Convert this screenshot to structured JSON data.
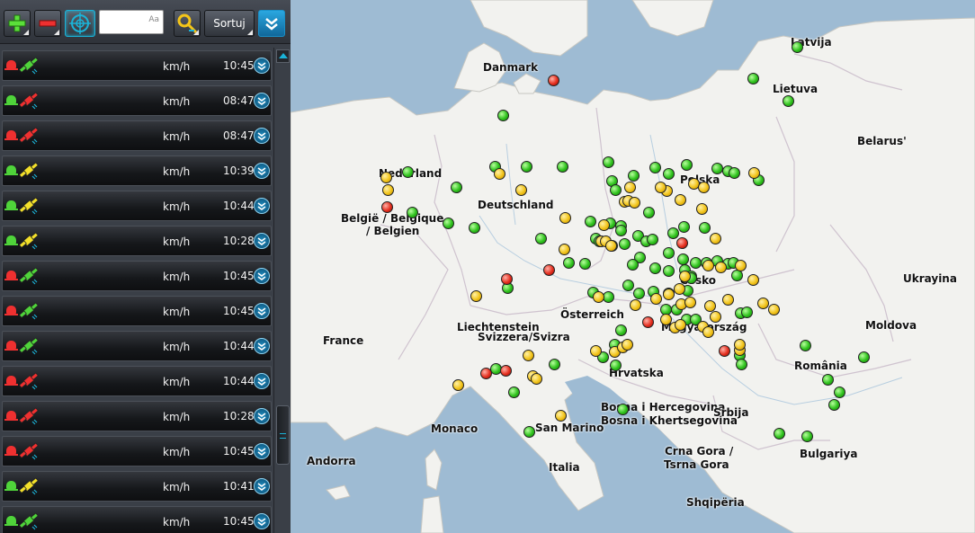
{
  "toolbar": {
    "search_value": "",
    "search_case_label": "Aa",
    "sort_label": "Sortuj"
  },
  "units": "km/h",
  "vehicles": [
    {
      "alarm": "red",
      "icon": "satellite-green-icon",
      "time": "10:45"
    },
    {
      "alarm": "green",
      "icon": "satellite-red-icon",
      "time": "08:47"
    },
    {
      "alarm": "red",
      "icon": "satellite-red-icon",
      "time": "08:47"
    },
    {
      "alarm": "green",
      "icon": "satellite-yellow-icon",
      "time": "10:39"
    },
    {
      "alarm": "green",
      "icon": "satellite-yellow-icon",
      "time": "10:44"
    },
    {
      "alarm": "green",
      "icon": "satellite-yellow-icon",
      "time": "10:28"
    },
    {
      "alarm": "red",
      "icon": "satellite-green-icon",
      "time": "10:45"
    },
    {
      "alarm": "red",
      "icon": "satellite-green-icon",
      "time": "10:45"
    },
    {
      "alarm": "red",
      "icon": "satellite-green-icon",
      "time": "10:44"
    },
    {
      "alarm": "red",
      "icon": "satellite-red-icon",
      "time": "10:44"
    },
    {
      "alarm": "red",
      "icon": "satellite-red-icon",
      "time": "10:28"
    },
    {
      "alarm": "red",
      "icon": "satellite-red-icon",
      "time": "10:45"
    },
    {
      "alarm": "green",
      "icon": "satellite-yellow-icon",
      "time": "10:41"
    },
    {
      "alarm": "green",
      "icon": "satellite-green-icon",
      "time": "10:45"
    }
  ],
  "colors": {
    "green": "#2fc21d",
    "yellow": "#f2c41a",
    "red": "#e52f1f",
    "accent": "#1ab3d8",
    "water": "#9ebbd3",
    "land": "#f2f2ef"
  },
  "map": {
    "places": [
      "Latvija",
      "Danmark",
      "Lietuva",
      "Belarus'",
      "Nederland",
      "Deutschland",
      "België / Belgique",
      "/ Belgien",
      "Polska",
      "Ukrayina",
      "Česko",
      "Moldova",
      "France",
      "Liechtenstein",
      "Svizzera/Svizra",
      "Österreich",
      "Magyarország",
      "România",
      "Hrvatska",
      "Bosna i Hercegovina",
      "Bosna i Khertsegovina",
      "Srbija",
      "Monaco",
      "San Marino",
      "Crna Gora /",
      "Tsrna Gora",
      "Andorra",
      "Italia",
      "Bulgariya",
      "Shqipëria"
    ],
    "markers": {
      "green": 88,
      "yellow": 44,
      "red": 9
    }
  }
}
